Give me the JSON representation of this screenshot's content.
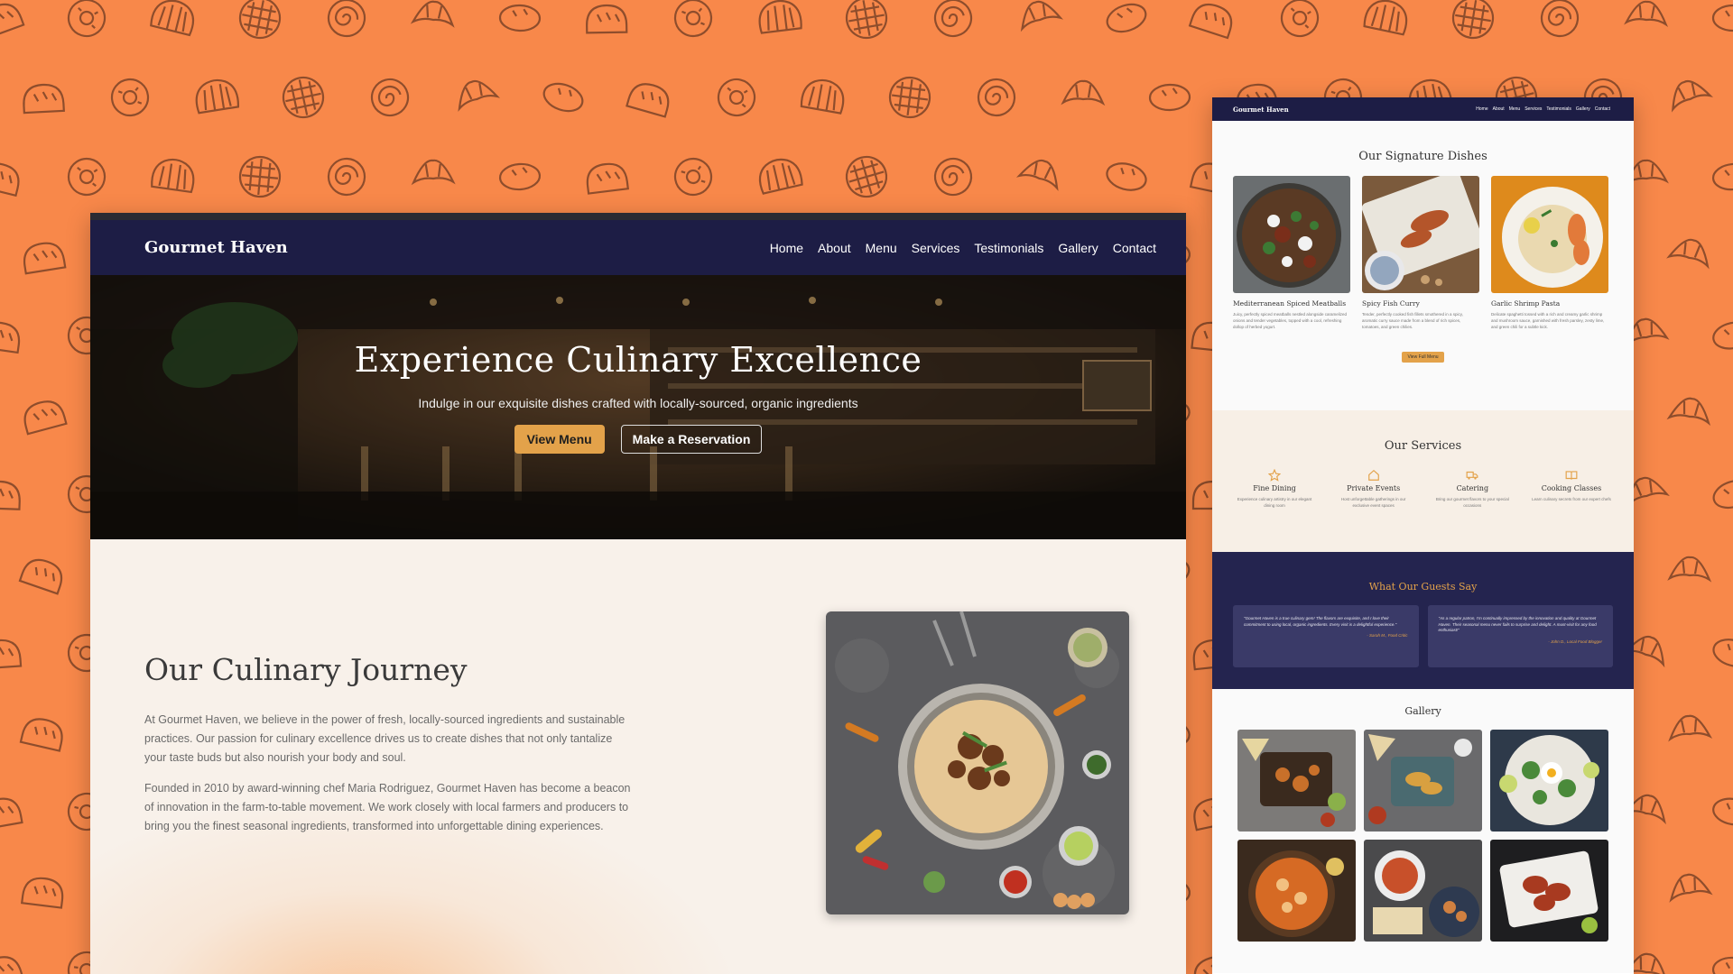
{
  "colors": {
    "background": "#f8884a",
    "pattern_stroke": "#6b3a22",
    "nav_bg": "#1d1d45",
    "accent": "#e3a24a",
    "testimonials_bg": "#24244f"
  },
  "desktop": {
    "brand": "Gourmet Haven",
    "nav": [
      "Home",
      "About",
      "Menu",
      "Services",
      "Testimonials",
      "Gallery",
      "Contact"
    ],
    "hero": {
      "title": "Experience Culinary Excellence",
      "subtitle": "Indulge in our exquisite dishes crafted with locally-sourced, organic ingredients",
      "primary_button": "View Menu",
      "secondary_button": "Make a Reservation"
    },
    "about": {
      "title": "Our Culinary Journey",
      "paragraph1": "At Gourmet Haven, we believe in the power of fresh, locally-sourced ingredients and sustainable practices. Our passion for culinary excellence drives us to create dishes that not only tantalize your taste buds but also nourish your body and soul.",
      "paragraph2": "Founded in 2010 by award-winning chef Maria Rodriguez, Gourmet Haven has become a beacon of innovation in the farm-to-table movement. We work closely with local farmers and producers to bring you the finest seasonal ingredients, transformed into unforgettable dining experiences."
    }
  },
  "mobile": {
    "brand": "Gourmet Haven",
    "nav": [
      "Home",
      "About",
      "Menu",
      "Services",
      "Testimonials",
      "Gallery",
      "Contact"
    ],
    "signature": {
      "title": "Our Signature Dishes",
      "dishes": [
        {
          "name": "Mediterranean Spiced Meatballs",
          "desc": "Juicy, perfectly spiced meatballs nestled alongside caramelized onions and tender vegetables, topped with a cool, refreshing dollop of herbed yogurt."
        },
        {
          "name": "Spicy Fish Curry",
          "desc": "Tender, perfectly cooked fish fillets smothered in a spicy, aromatic curry sauce made from a blend of rich spices, tomatoes, and green chilies."
        },
        {
          "name": "Garlic Shrimp Pasta",
          "desc": "Delicate spaghetti tossed with a rich and creamy garlic shrimp and mushroom sauce, garnished with fresh parsley, zesty lime, and green chili for a subtle kick."
        }
      ],
      "button": "View Full Menu"
    },
    "services": {
      "title": "Our Services",
      "items": [
        {
          "icon": "star-icon",
          "title": "Fine Dining",
          "desc": "Experience culinary artistry in our elegant dining room"
        },
        {
          "icon": "home-icon",
          "title": "Private Events",
          "desc": "Host unforgettable gatherings in our exclusive event spaces"
        },
        {
          "icon": "truck-icon",
          "title": "Catering",
          "desc": "Bring our gourmet flavors to your special occasions"
        },
        {
          "icon": "book-icon",
          "title": "Cooking Classes",
          "desc": "Learn culinary secrets from our expert chefs"
        }
      ]
    },
    "testimonials": {
      "title": "What Our Guests Say",
      "items": [
        {
          "quote": "\"Gourmet Haven is a true culinary gem! The flavors are exquisite, and I love their commitment to using local, organic ingredients. Every visit is a delightful experience.\"",
          "author": "- Sarah M., Food Critic"
        },
        {
          "quote": "\"As a regular patron, I'm continually impressed by the innovation and quality at Gourmet Haven. Their seasonal menu never fails to surprise and delight. A must-visit for any food enthusiast!\"",
          "author": "- John D., Local Food Blogger"
        }
      ]
    },
    "gallery": {
      "title": "Gallery"
    }
  }
}
